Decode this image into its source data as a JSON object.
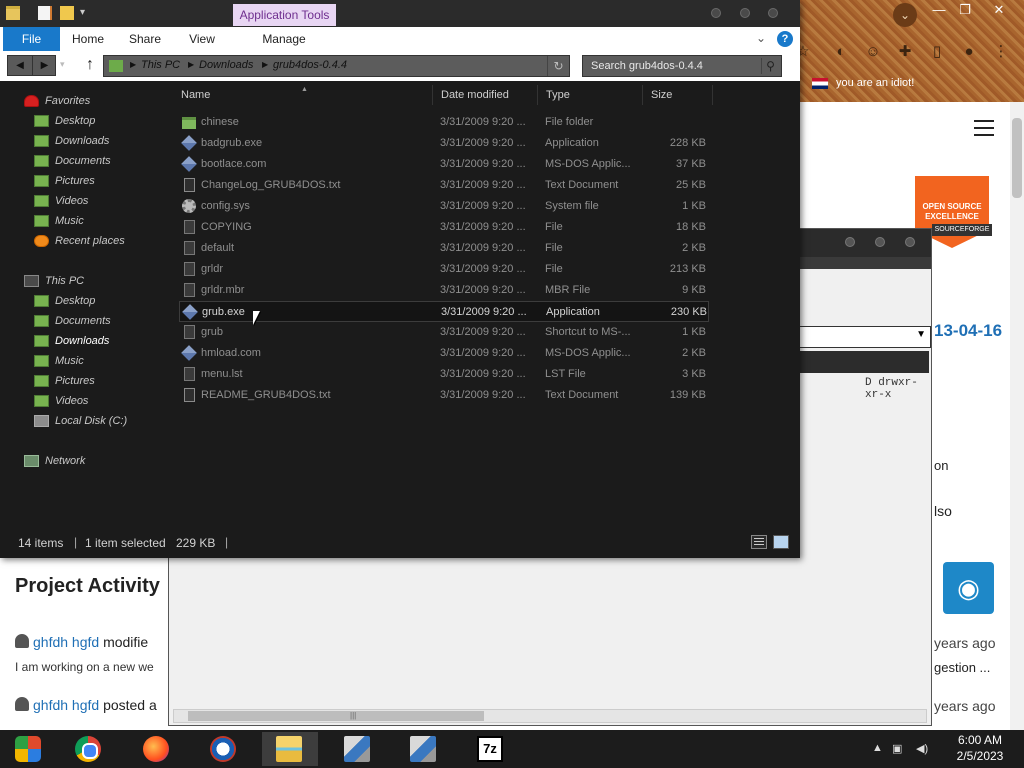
{
  "browser": {
    "bookmark_label": "you are an idiot!",
    "page": {
      "date_fragment": "13-04-16",
      "project_activity_heading": "Project Activity",
      "fragment_on": "on",
      "fragment_also": "lso",
      "activity": [
        {
          "user": "ghfdh hgfd",
          "action": "modifie",
          "ago": "years ago",
          "desc": "I am working on a new we",
          "desc_tail": "gestion ..."
        },
        {
          "user": "ghfdh hgfd",
          "action": "posted a",
          "ago": "years ago",
          "desc": "I am working on a new we",
          "desc_tail": "gestion ..."
        }
      ]
    }
  },
  "middle_window": {
    "permissions_text": "D drwxr-xr-x"
  },
  "explorer": {
    "app_tools_label": "Application Tools",
    "ribbon_tabs": [
      {
        "label": "File"
      },
      {
        "label": "Home"
      },
      {
        "label": "Share"
      },
      {
        "label": "View"
      },
      {
        "label": "Manage"
      }
    ],
    "address_crumbs": [
      "This PC",
      "Downloads",
      "grub4dos-0.4.4"
    ],
    "search_placeholder": "Search grub4dos-0.4.4",
    "nav": {
      "favorites_label": "Favorites",
      "favorites": [
        "Desktop",
        "Downloads",
        "Documents",
        "Pictures",
        "Videos",
        "Music",
        "Recent places"
      ],
      "this_pc_label": "This PC",
      "this_pc": [
        "Desktop",
        "Documents",
        "Downloads",
        "Music",
        "Pictures",
        "Videos",
        "Local Disk (C:)"
      ],
      "network_label": "Network",
      "selected": "Downloads"
    },
    "columns": {
      "name": "Name",
      "date_modified": "Date modified",
      "type": "Type",
      "size": "Size"
    },
    "files": [
      {
        "name": "chinese",
        "date": "3/31/2009 9:20 ...",
        "type": "File folder",
        "size": "",
        "icon": "folder-icon"
      },
      {
        "name": "badgrub.exe",
        "date": "3/31/2009 9:20 ...",
        "type": "Application",
        "size": "228 KB",
        "icon": "exe-icon"
      },
      {
        "name": "bootlace.com",
        "date": "3/31/2009 9:20 ...",
        "type": "MS-DOS Applic...",
        "size": "37 KB",
        "icon": "exe-icon"
      },
      {
        "name": "ChangeLog_GRUB4DOS.txt",
        "date": "3/31/2009 9:20 ...",
        "type": "Text Document",
        "size": "25 KB",
        "icon": "text-file-icon"
      },
      {
        "name": "config.sys",
        "date": "3/31/2009 9:20 ...",
        "type": "System file",
        "size": "1 KB",
        "icon": "gear-file-icon"
      },
      {
        "name": "COPYING",
        "date": "3/31/2009 9:20 ...",
        "type": "File",
        "size": "18 KB",
        "icon": "file-icon"
      },
      {
        "name": "default",
        "date": "3/31/2009 9:20 ...",
        "type": "File",
        "size": "2 KB",
        "icon": "file-icon"
      },
      {
        "name": "grldr",
        "date": "3/31/2009 9:20 ...",
        "type": "File",
        "size": "213 KB",
        "icon": "file-icon"
      },
      {
        "name": "grldr.mbr",
        "date": "3/31/2009 9:20 ...",
        "type": "MBR File",
        "size": "9 KB",
        "icon": "file-icon"
      },
      {
        "name": "grub.exe",
        "date": "3/31/2009 9:20 ...",
        "type": "Application",
        "size": "230 KB",
        "icon": "exe-icon",
        "selected": true
      },
      {
        "name": "grub",
        "date": "3/31/2009 9:20 ...",
        "type": "Shortcut to MS-...",
        "size": "1 KB",
        "icon": "file-icon"
      },
      {
        "name": "hmload.com",
        "date": "3/31/2009 9:20 ...",
        "type": "MS-DOS Applic...",
        "size": "2 KB",
        "icon": "exe-icon"
      },
      {
        "name": "menu.lst",
        "date": "3/31/2009 9:20 ...",
        "type": "LST File",
        "size": "3 KB",
        "icon": "file-icon"
      },
      {
        "name": "README_GRUB4DOS.txt",
        "date": "3/31/2009 9:20 ...",
        "type": "Text Document",
        "size": "139 KB",
        "icon": "text-file-icon"
      }
    ],
    "status": {
      "items": "14 items",
      "selected": "1 item selected",
      "selected_size": "229 KB"
    },
    "colors": {
      "file_tab": "#1979ca",
      "app_tools_bg": "#e8d6f3",
      "app_tools_text": "#6f2f8f",
      "folder": "#7fb85d"
    }
  },
  "taskbar": {
    "apps": [
      "windows-start-icon",
      "chrome-icon",
      "firefox-icon",
      "internet-explorer-icon",
      "file-explorer-icon",
      "installer-icon",
      "installer-icon",
      "7zip-icon"
    ],
    "sevenzip_label": "7z",
    "time": "6:00 AM",
    "date": "2/5/2023"
  }
}
